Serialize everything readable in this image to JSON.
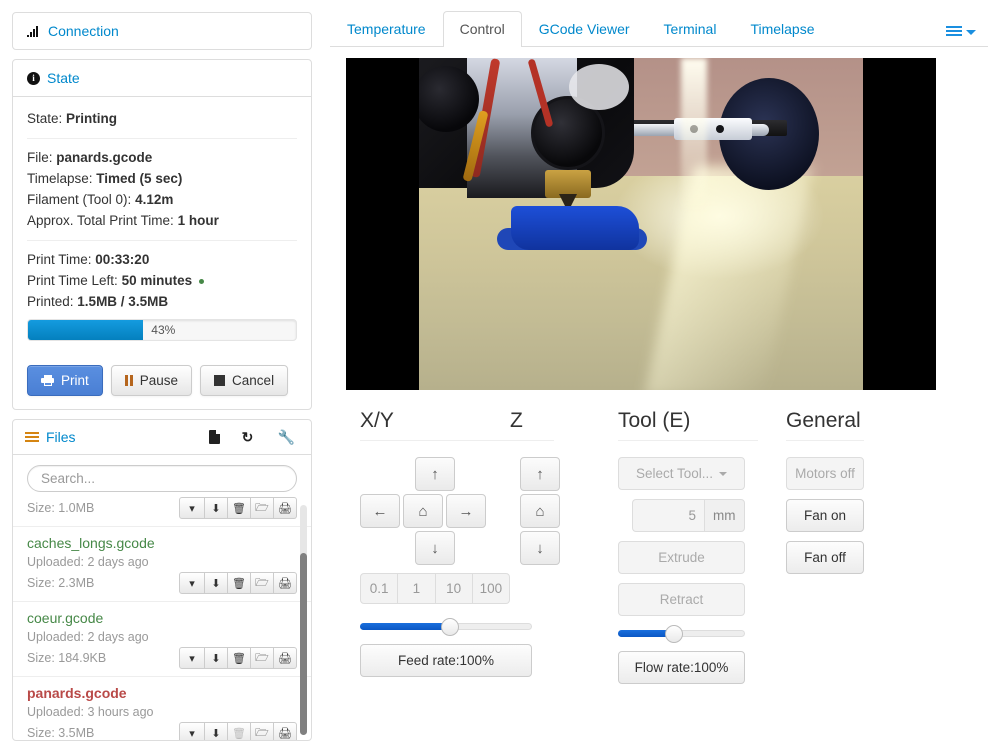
{
  "connection": {
    "title": "Connection",
    "icon": "signal-icon"
  },
  "state": {
    "title": "State",
    "icon": "info-circle-icon",
    "rows": [
      {
        "label": "State:",
        "value": "Printing"
      }
    ],
    "file_rows": [
      {
        "label": "File:",
        "value": "panards.gcode"
      },
      {
        "label": "Timelapse:",
        "value": "Timed (5 sec)"
      },
      {
        "label": "Filament (Tool 0):",
        "value": "4.12m"
      },
      {
        "label": "Approx. Total Print Time:",
        "value": "1 hour"
      }
    ],
    "time_rows": [
      {
        "label": "Print Time:",
        "value": "00:33:20"
      },
      {
        "label": "Print Time Left:",
        "value": "50 minutes"
      },
      {
        "label": "Printed:",
        "value": "1.5MB / 3.5MB"
      }
    ],
    "progress": {
      "percent": 43,
      "label": "43%"
    },
    "buttons": {
      "print": "Print",
      "pause": "Pause",
      "cancel": "Cancel"
    }
  },
  "files": {
    "title": "Files",
    "icon": "list-icon",
    "header_actions": [
      "file-icon",
      "refresh-icon",
      "wrench-icon"
    ],
    "search": {
      "placeholder": "Search...",
      "value": ""
    },
    "row_actions": [
      "chevron-down-icon",
      "download-icon",
      "trash-icon",
      "folder-open-icon",
      "print-icon"
    ],
    "items": [
      {
        "name": "",
        "uploaded": "",
        "size": "Size: 1.0MB",
        "state": "ok",
        "partial": true
      },
      {
        "name": "caches_longs.gcode",
        "uploaded": "Uploaded: 2 days ago",
        "size": "Size: 2.3MB",
        "state": "ok",
        "partial": false
      },
      {
        "name": "coeur.gcode",
        "uploaded": "Uploaded: 2 days ago",
        "size": "Size: 184.9KB",
        "state": "ok",
        "partial": false
      },
      {
        "name": "panards.gcode",
        "uploaded": "Uploaded: 3 hours ago",
        "size": "Size: 3.5MB",
        "state": "active",
        "partial": false
      }
    ]
  },
  "tabs": {
    "items": [
      {
        "label": "Temperature",
        "active": false
      },
      {
        "label": "Control",
        "active": true
      },
      {
        "label": "GCode Viewer",
        "active": false
      },
      {
        "label": "Terminal",
        "active": false
      },
      {
        "label": "Timelapse",
        "active": false
      }
    ],
    "menu_icon": "hamburger-icon"
  },
  "webcam": {
    "alt": "printer-webcam-stream"
  },
  "control": {
    "xy": {
      "title": "X/Y",
      "up": "↑",
      "left": "←",
      "home": "⌂",
      "right": "→",
      "down": "↓",
      "steps": [
        "0.1",
        "1",
        "10",
        "100"
      ],
      "slider_percent": 52,
      "rate_label": "Feed rate:100%"
    },
    "z": {
      "title": "Z",
      "up": "↑",
      "home": "⌂",
      "down": "↓"
    },
    "tool": {
      "title": "Tool (E)",
      "select_tool": "Select Tool...",
      "amount_value": "5",
      "amount_unit": "mm",
      "extrude": "Extrude",
      "retract": "Retract",
      "slider_percent": 43,
      "rate_label": "Flow rate:100%"
    },
    "general": {
      "title": "General",
      "motors_off": "Motors off",
      "fan_on": "Fan on",
      "fan_off": "Fan off"
    }
  },
  "colors": {
    "link": "#08c",
    "primary": "#4a7fd4",
    "progress": "#0480be",
    "file_ok": "#468847",
    "file_active": "#b94a48"
  }
}
